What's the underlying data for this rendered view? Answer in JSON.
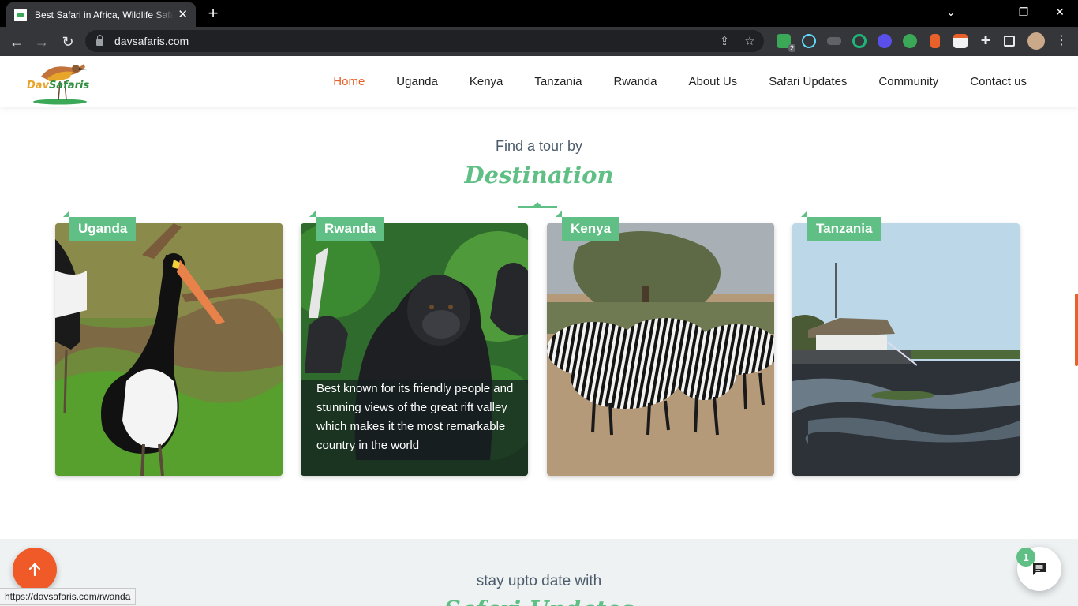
{
  "browser": {
    "tab_title": "Best Safari in Africa, Wildlife Safaris",
    "url": "davsafaris.com",
    "status_url": "https://davsafaris.com/rwanda",
    "extension_badge": "2"
  },
  "site": {
    "logo": {
      "part1": "Dav",
      "part2": "Safaris"
    },
    "nav": [
      {
        "label": "Home",
        "active": true
      },
      {
        "label": "Uganda"
      },
      {
        "label": "Kenya"
      },
      {
        "label": "Tanzania"
      },
      {
        "label": "Rwanda"
      },
      {
        "label": "About Us"
      },
      {
        "label": "Safari Updates"
      },
      {
        "label": "Community"
      },
      {
        "label": "Contact us"
      }
    ]
  },
  "destinations": {
    "pretitle": "Find a tour by",
    "title": "Destination",
    "cards": [
      {
        "name": "Uganda",
        "description": ""
      },
      {
        "name": "Rwanda",
        "description": "Best known for its friendly people and stunning views of the great rift valley which makes it the most remarkable country in the world"
      },
      {
        "name": "Kenya",
        "description": ""
      },
      {
        "name": "Tanzania",
        "description": ""
      }
    ]
  },
  "updates": {
    "pretitle": "stay upto date with",
    "title": "Safari Updates"
  },
  "chat": {
    "unread_count": "1"
  },
  "colors": {
    "accent": "#5fbf84",
    "active_nav": "#e8602a",
    "fab": "#f05a28"
  }
}
